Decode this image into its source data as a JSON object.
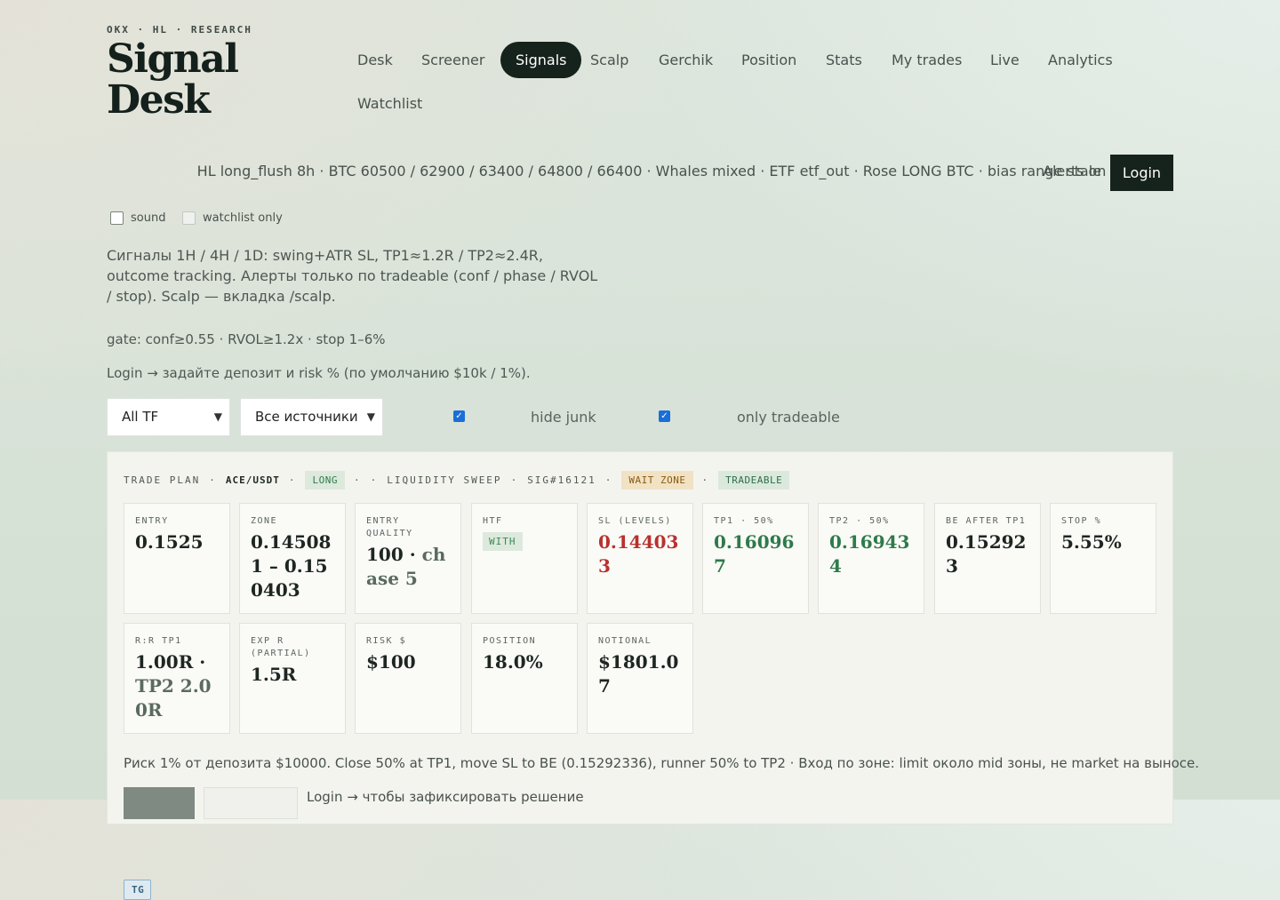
{
  "brand": {
    "kicker": "OKX · HL · RESEARCH",
    "title": "Signal Desk"
  },
  "nav": {
    "items": [
      "Desk",
      "Screener",
      "Signals",
      "Scalp",
      "Gerchik",
      "Position",
      "Stats",
      "My trades",
      "Live",
      "Analytics",
      "Watchlist"
    ],
    "active": "Signals"
  },
  "status": {
    "text": "HL long_flush 8h · BTC 60500 / 62900 / 63400 / 64800 / 66400 · Whales mixed · ETF etf_out · Rose LONG BTC · bias range stale",
    "alerts": "Alerts on",
    "login": "Login"
  },
  "options": {
    "sound": "sound",
    "watchlist_only": "watchlist only"
  },
  "description": "Сигналы 1H / 4H / 1D: swing+ATR SL, TP1≈1.2R / TP2≈2.4R, outcome tracking. Алерты только по tradeable (conf / phase / RVOL / stop). Scalp — вкладка /scalp.",
  "gate": "gate: conf≥0.55 · RVOL≥1.2x · stop 1–6%",
  "login_hint": "Login → задайте депозит и risk % (по умолчанию $10k / 1%).",
  "filters": {
    "tf": "All TF",
    "source": "Все источники",
    "hide_junk": "hide junk",
    "only_tradeable": "only tradeable"
  },
  "plan": {
    "label": "TRADE PLAN",
    "pair": "ACE/USDT",
    "side": "LONG",
    "tg": "TG",
    "setup": "LIQUIDITY SWEEP",
    "sig": "SIG#16121",
    "zone_status": "WAIT ZONE",
    "tradeable": "TRADEABLE",
    "cells": {
      "entry": {
        "label": "ENTRY",
        "value": "0.1525"
      },
      "zone": {
        "label": "ZONE",
        "value": "0.145081 – 0.150403"
      },
      "quality": {
        "label": "ENTRY QUALITY",
        "value": "100 ·",
        "sub": "chase 5"
      },
      "htf": {
        "label": "HTF",
        "value": "WITH"
      },
      "sl": {
        "label": "SL (LEVELS)",
        "value": "0.144033"
      },
      "tp1": {
        "label": "TP1 · 50%",
        "value": "0.160967"
      },
      "tp2": {
        "label": "TP2 · 50%",
        "value": "0.169434"
      },
      "be": {
        "label": "BE AFTER TP1",
        "value": "0.152923"
      },
      "stop": {
        "label": "STOP %",
        "value": "5.55%"
      },
      "rr": {
        "label": "R:R TP1",
        "value": "1.00R ·",
        "sub": "TP2 2.00R"
      },
      "exp": {
        "label": "EXP R (PARTIAL)",
        "value": "1.5R"
      },
      "risk": {
        "label": "RISK $",
        "value": "$100"
      },
      "position": {
        "label": "POSITION",
        "value": "18.0%"
      },
      "notional": {
        "label": "NOTIONAL",
        "value": "$1801.07"
      }
    },
    "risk_line": "Риск 1% от депозита $10000. Close 50% at TP1, move SL to BE (0.15292336), runner 50% to TP2 · Вход по зоне: limit около mid зоны, не market на выносе.",
    "action_hint": "Login → чтобы зафиксировать решение"
  }
}
